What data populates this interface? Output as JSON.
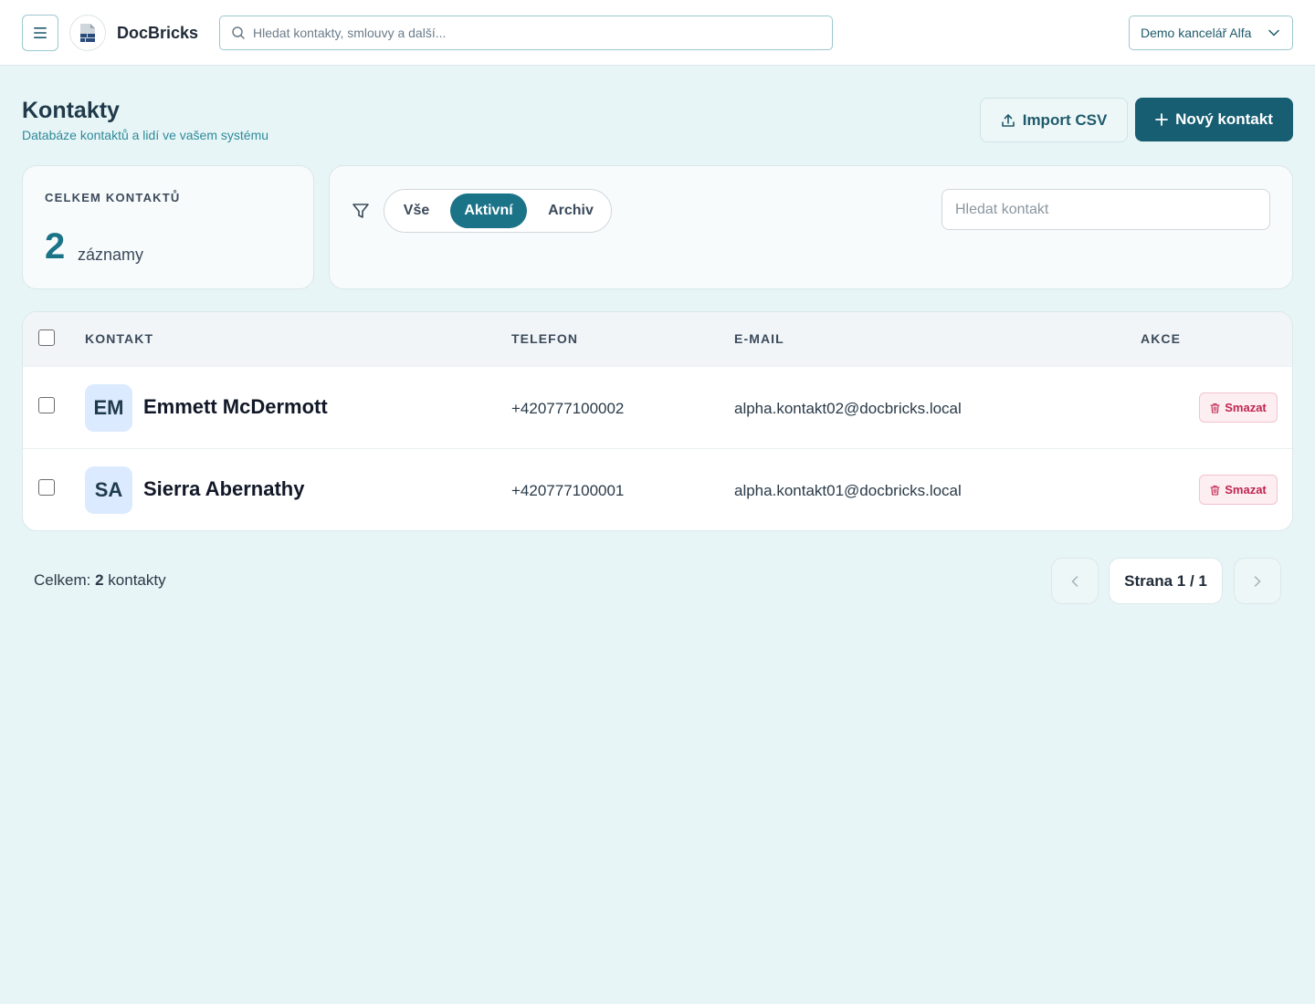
{
  "topbar": {
    "brand": "DocBricks",
    "search_placeholder": "Hledat kontakty, smlouvy a další...",
    "office": "Demo kancelář Alfa"
  },
  "header": {
    "title": "Kontakty",
    "subtitle": "Databáze kontaktů a lidí ve vašem systému",
    "import_label": "Import CSV",
    "new_label": "Nový kontakt"
  },
  "stats": {
    "label": "CELKEM KONTAKTŮ",
    "count": "2",
    "unit": "záznamy"
  },
  "filter": {
    "tabs": [
      {
        "label": "Vše",
        "active": false
      },
      {
        "label": "Aktivní",
        "active": true
      },
      {
        "label": "Archiv",
        "active": false
      }
    ],
    "search_placeholder": "Hledat kontakt"
  },
  "table": {
    "headers": {
      "contact": "KONTAKT",
      "phone": "TELEFON",
      "email": "E-MAIL",
      "actions": "AKCE"
    },
    "delete_label": "Smazat",
    "rows": [
      {
        "initials": "EM",
        "name": "Emmett McDermott",
        "phone": "+420777100002",
        "email": "alpha.kontakt02@docbricks.local"
      },
      {
        "initials": "SA",
        "name": "Sierra Abernathy",
        "phone": "+420777100001",
        "email": "alpha.kontakt01@docbricks.local"
      }
    ]
  },
  "footer": {
    "total_prefix": "Celkem:",
    "total_count": "2",
    "total_suffix": "kontakty",
    "page_label": "Strana 1 / 1"
  },
  "colors": {
    "accent": "#175e72",
    "active_tab": "#1b7388",
    "danger": "#c0264f",
    "background": "#e8f5f6"
  }
}
